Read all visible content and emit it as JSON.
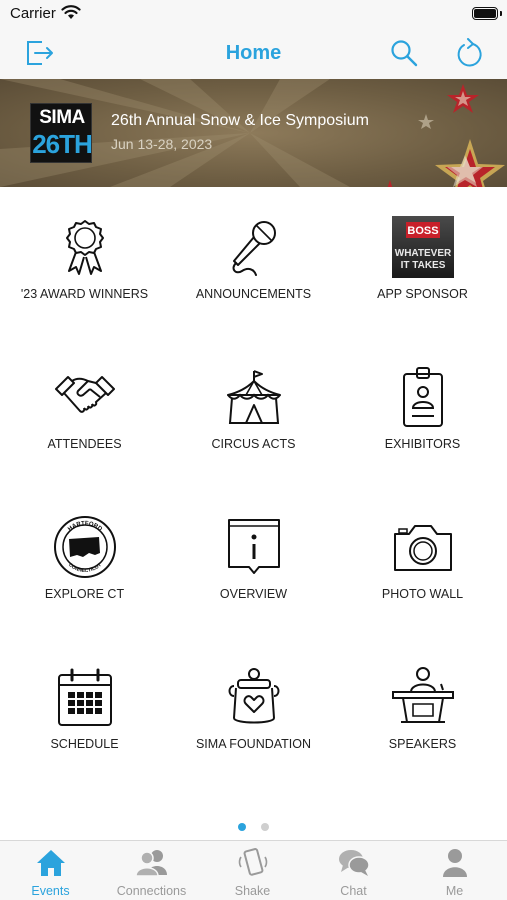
{
  "status": {
    "carrier": "Carrier"
  },
  "nav": {
    "title": "Home"
  },
  "banner": {
    "logo_top": "SIMA",
    "logo_bottom": "26TH",
    "title": "26th Annual Snow & Ice Symposium",
    "dates": "Jun 13-28, 2023"
  },
  "tiles": [
    {
      "label": "'23 AWARD WINNERS",
      "icon": "award-ribbon-icon"
    },
    {
      "label": "ANNOUNCEMENTS",
      "icon": "microphone-icon"
    },
    {
      "label": "APP SPONSOR",
      "icon": "boss-sponsor-logo"
    },
    {
      "label": "ATTENDEES",
      "icon": "handshake-icon"
    },
    {
      "label": "CIRCUS ACTS",
      "icon": "circus-tent-icon"
    },
    {
      "label": "EXHIBITORS",
      "icon": "badge-icon"
    },
    {
      "label": "EXPLORE CT",
      "icon": "connecticut-seal-icon"
    },
    {
      "label": "OVERVIEW",
      "icon": "info-icon"
    },
    {
      "label": "PHOTO WALL",
      "icon": "camera-icon"
    },
    {
      "label": "SCHEDULE",
      "icon": "calendar-icon"
    },
    {
      "label": "SIMA FOUNDATION",
      "icon": "donation-jar-icon"
    },
    {
      "label": "SPEAKERS",
      "icon": "podium-icon"
    }
  ],
  "sponsor": {
    "brand": "BOSS",
    "tagline_1": "WHATEVER",
    "tagline_2": "IT TAKES"
  },
  "seal": {
    "top": "HARTFORD",
    "bottom": "CONNECTICUT"
  },
  "pager": {
    "current": 1,
    "total": 2
  },
  "tabs": [
    {
      "label": "Events",
      "icon": "home-icon",
      "active": true
    },
    {
      "label": "Connections",
      "icon": "people-icon",
      "active": false
    },
    {
      "label": "Shake",
      "icon": "shake-phone-icon",
      "active": false
    },
    {
      "label": "Chat",
      "icon": "chat-bubbles-icon",
      "active": false
    },
    {
      "label": "Me",
      "icon": "person-icon",
      "active": false
    }
  ],
  "colors": {
    "accent": "#2ba3dd",
    "inactive": "#9a9a9a",
    "bar_background": "#f7f7f7",
    "banner_star": "#b8242a"
  }
}
